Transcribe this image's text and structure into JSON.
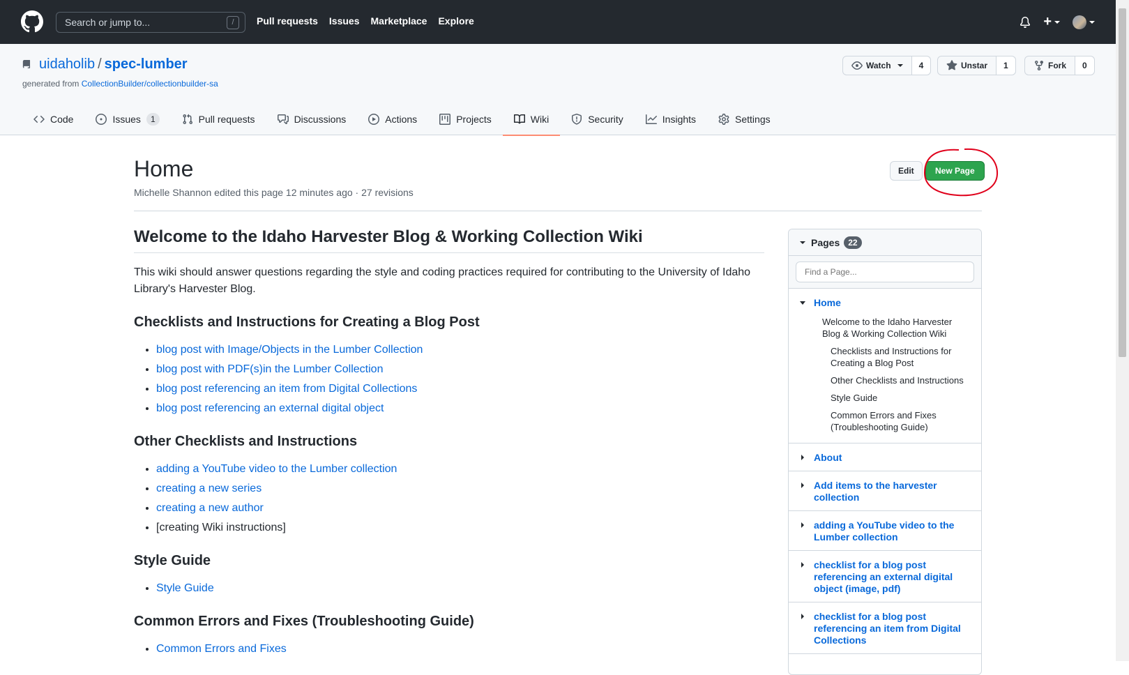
{
  "topnav": {
    "search_placeholder": "Search or jump to...",
    "slash_hint": "/",
    "links": [
      "Pull requests",
      "Issues",
      "Marketplace",
      "Explore"
    ],
    "plus": "+"
  },
  "repo": {
    "owner": "uidaholib",
    "separator": "/",
    "name": "spec-lumber",
    "generated_from_label": "generated from",
    "generated_from_link": "CollectionBuilder/collectionbuilder-sa",
    "watch_label": "Watch",
    "watch_count": "4",
    "unstar_label": "Unstar",
    "star_count": "1",
    "fork_label": "Fork",
    "fork_count": "0"
  },
  "tabs": [
    {
      "label": "Code",
      "icon": "code-icon"
    },
    {
      "label": "Issues",
      "icon": "issue-icon",
      "counter": "1"
    },
    {
      "label": "Pull requests",
      "icon": "pull-request-icon"
    },
    {
      "label": "Discussions",
      "icon": "discussions-icon"
    },
    {
      "label": "Actions",
      "icon": "actions-icon"
    },
    {
      "label": "Projects",
      "icon": "projects-icon"
    },
    {
      "label": "Wiki",
      "icon": "book-icon",
      "selected": true
    },
    {
      "label": "Security",
      "icon": "shield-icon"
    },
    {
      "label": "Insights",
      "icon": "graph-icon"
    },
    {
      "label": "Settings",
      "icon": "gear-icon"
    }
  ],
  "page": {
    "title": "Home",
    "meta": "Michelle Shannon edited this page 12 minutes ago · 27 revisions",
    "edit_label": "Edit",
    "new_page_label": "New Page"
  },
  "content": {
    "h1": "Welcome to the Idaho Harvester Blog & Working Collection Wiki",
    "intro": "This wiki should answer questions regarding the style and coding practices required for contributing to the University of Idaho Library's Harvester Blog.",
    "sections": [
      {
        "heading": "Checklists and Instructions for Creating a Blog Post",
        "items": [
          {
            "text": "blog post with Image/Objects in the Lumber Collection",
            "link": true
          },
          {
            "text": "blog post with PDF(s)in the Lumber Collection",
            "link": true
          },
          {
            "text": "blog post referencing an item from Digital Collections",
            "link": true
          },
          {
            "text": "blog post referencing an external digital object",
            "link": true
          }
        ]
      },
      {
        "heading": "Other Checklists and Instructions",
        "items": [
          {
            "text": "adding a YouTube video to the Lumber collection",
            "link": true
          },
          {
            "text": "creating a new series",
            "link": true
          },
          {
            "text": "creating a new author",
            "link": true
          },
          {
            "text": "[creating Wiki instructions]",
            "link": false
          }
        ]
      },
      {
        "heading": "Style Guide",
        "items": [
          {
            "text": "Style Guide",
            "link": true
          }
        ]
      },
      {
        "heading": "Common Errors and Fixes (Troubleshooting Guide)",
        "items": [
          {
            "text": "Common Errors and Fixes",
            "link": true
          }
        ]
      }
    ]
  },
  "sidebar": {
    "pages_label": "Pages",
    "pages_count": "22",
    "find_placeholder": "Find a Page...",
    "home": {
      "label": "Home",
      "toc": [
        {
          "text": "Welcome to the Idaho Harvester Blog & Working Collection Wiki",
          "level": 1
        },
        {
          "text": "Checklists and Instructions for Creating a Blog Post",
          "level": 2
        },
        {
          "text": "Other Checklists and Instructions",
          "level": 2
        },
        {
          "text": "Style Guide",
          "level": 2
        },
        {
          "text": "Common Errors and Fixes (Troubleshooting Guide)",
          "level": 2
        }
      ]
    },
    "pages": [
      "About",
      "Add items to the harvester collection",
      "adding a YouTube video to the Lumber collection",
      "checklist for a blog post referencing an external digital object (image, pdf)",
      "checklist for a blog post referencing an item from Digital Collections"
    ]
  },
  "colors": {
    "header_bg": "#24292f",
    "link": "#0969da",
    "new_page_bg": "#2da44e",
    "annotation_red": "#e0001b",
    "selected_tab_underline": "#fd8c73"
  }
}
